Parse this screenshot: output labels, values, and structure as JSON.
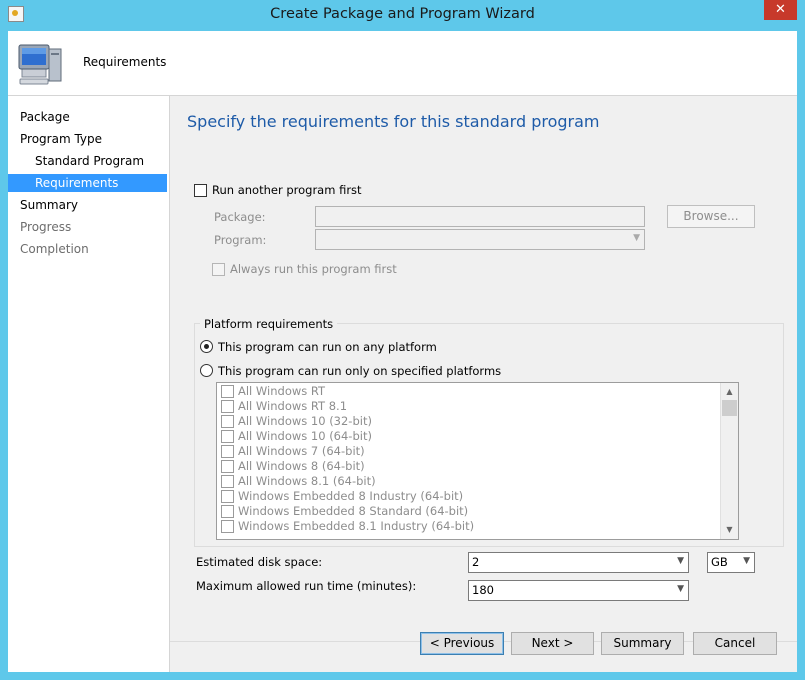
{
  "window": {
    "title": "Create Package and Program Wizard",
    "close_glyph": "✕"
  },
  "header": {
    "title": "Requirements",
    "icon": "computer-icon"
  },
  "nav": {
    "items": [
      {
        "label": "Package",
        "state": "normal"
      },
      {
        "label": "Program Type",
        "state": "normal"
      },
      {
        "label": "Standard Program",
        "state": "normal"
      },
      {
        "label": "Requirements",
        "state": "active"
      },
      {
        "label": "Summary",
        "state": "normal"
      },
      {
        "label": "Progress",
        "state": "gray"
      },
      {
        "label": "Completion",
        "state": "gray"
      }
    ]
  },
  "main": {
    "page_title": "Specify the requirements for this standard program",
    "run_another": {
      "label": "Run another program first",
      "checked": false
    },
    "package_label": "Package:",
    "package_value": "",
    "browse_label": "Browse...",
    "program_label": "Program:",
    "program_value": "",
    "always_run": {
      "label": "Always run this program first",
      "checked": false
    },
    "platform": {
      "legend": "Platform requirements",
      "any_label": "This program can run on any platform",
      "specified_label": "This program can run only on specified platforms",
      "selected": "any",
      "items": [
        "All Windows RT",
        "All Windows RT 8.1",
        "All Windows 10 (32-bit)",
        "All Windows 10 (64-bit)",
        "All Windows 7 (64-bit)",
        "All Windows 8 (64-bit)",
        "All Windows 8.1 (64-bit)",
        "Windows Embedded 8 Industry (64-bit)",
        "Windows Embedded 8 Standard (64-bit)",
        "Windows Embedded 8.1 Industry (64-bit)"
      ]
    },
    "disk_space": {
      "label": "Estimated disk space:",
      "value": "2",
      "unit": "GB"
    },
    "max_runtime": {
      "label": "Maximum allowed run time (minutes):",
      "value": "180"
    }
  },
  "footer": {
    "previous": "< Previous",
    "next": "Next >",
    "summary": "Summary",
    "cancel": "Cancel"
  },
  "colors": {
    "title_bar": "#5ec8ea",
    "accent": "#3399ff",
    "heading": "#1e5ba8"
  }
}
